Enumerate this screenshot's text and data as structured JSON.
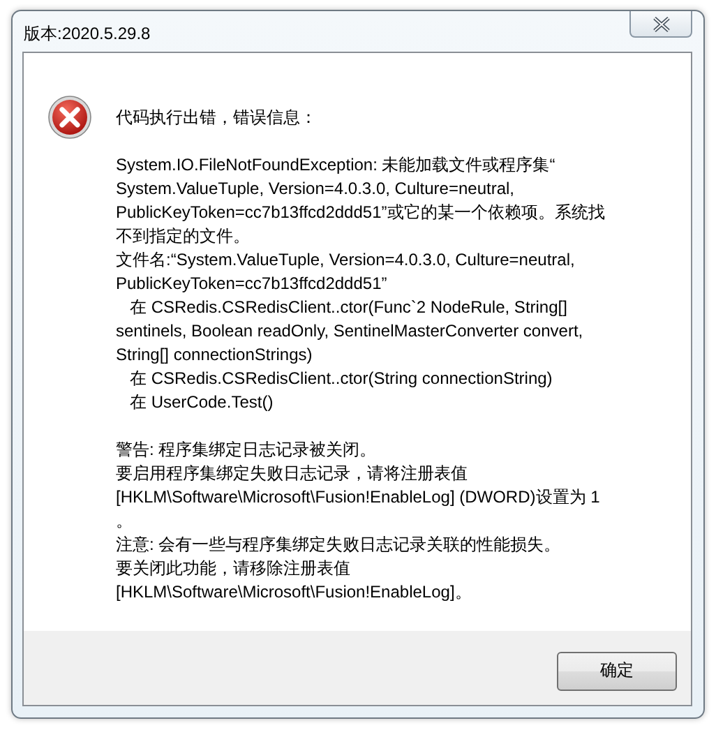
{
  "window": {
    "title": "版本:2020.5.29.8"
  },
  "message": {
    "heading": "代码执行出错，错误信息：",
    "sections": [
      [
        "System.IO.FileNotFoundException: 未能加载文件或程序集“",
        "System.ValueTuple, Version=4.0.3.0, Culture=neutral,",
        "PublicKeyToken=cc7b13ffcd2ddd51”或它的某一个依赖项。系统找",
        "不到指定的文件。",
        "文件名:“System.ValueTuple, Version=4.0.3.0, Culture=neutral,",
        "PublicKeyToken=cc7b13ffcd2ddd51”",
        "   在 CSRedis.CSRedisClient..ctor(Func`2 NodeRule, String[]",
        "sentinels, Boolean readOnly, SentinelMasterConverter convert,",
        "String[] connectionStrings)",
        "   在 CSRedis.CSRedisClient..ctor(String connectionString)",
        "   在 UserCode.Test()"
      ],
      [
        "警告: 程序集绑定日志记录被关闭。",
        "要启用程序集绑定失败日志记录，请将注册表值",
        "[HKLM\\Software\\Microsoft\\Fusion!EnableLog] (DWORD)设置为 1",
        "。",
        "注意: 会有一些与程序集绑定失败日志记录关联的性能损失。",
        "要关闭此功能，请移除注册表值",
        "[HKLM\\Software\\Microsoft\\Fusion!EnableLog]。"
      ]
    ]
  },
  "buttons": [
    "确定"
  ]
}
